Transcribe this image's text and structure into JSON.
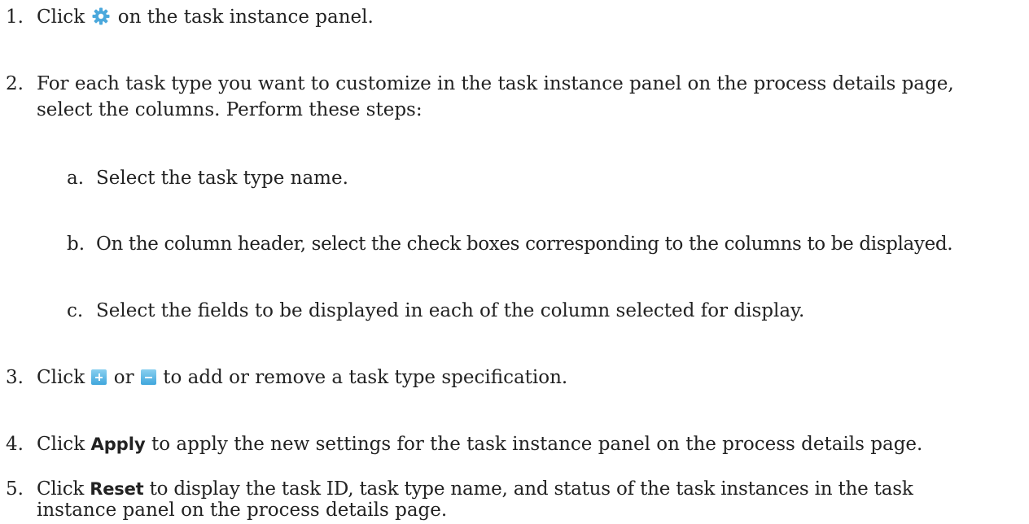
{
  "steps": [
    {
      "number": "1.",
      "before": "Click ",
      "icon": "gear-icon",
      "after": " on the task instance panel."
    },
    {
      "number": "2.",
      "line1": "For each task type you want to customize in the task instance panel on the process details page,",
      "line2": "select the columns. Perform these steps:",
      "substeps": [
        {
          "letter": "a.",
          "text": "Select the task type name."
        },
        {
          "letter": "b.",
          "text": "On the column header, select the check boxes corresponding to the columns to be displayed."
        },
        {
          "letter": "c.",
          "text": "Select the fields to be displayed in each of the column selected for display."
        }
      ]
    },
    {
      "number": "3.",
      "before": "Click ",
      "icon_add": "plus-icon",
      "middle": " or ",
      "icon_remove": "minus-icon",
      "after": " to add or remove a task type specification."
    },
    {
      "number": "4.",
      "before": "Click ",
      "bold": "Apply",
      "after": " to apply the new settings for the task instance panel on the process details page."
    },
    {
      "number": "5.",
      "before": "Click ",
      "bold": "Reset",
      "after": " to display the task ID, task type name, and status of the task instances in the task",
      "line2": "instance panel on the process details page."
    }
  ],
  "icon_color": "#3fa6dc"
}
